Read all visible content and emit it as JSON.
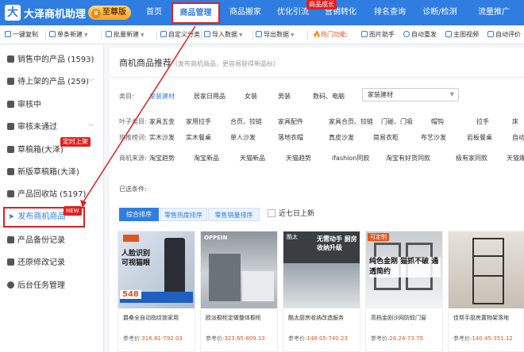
{
  "header": {
    "app_name": "大泽商机助理",
    "vip_label": "至尊版",
    "nav": [
      {
        "label": "首页"
      },
      {
        "label": "商品管理"
      },
      {
        "label": "商品搬家"
      },
      {
        "label": "优化引流"
      },
      {
        "label": "营销转化"
      },
      {
        "label": "排名查询"
      },
      {
        "label": "诊断/检测"
      },
      {
        "label": "流量推广"
      }
    ],
    "nav_badge": "商品成长"
  },
  "toolbar": {
    "items": [
      {
        "label": "一键复制",
        "icon": "copy-icon",
        "dropdown": false
      },
      {
        "label": "单条新建",
        "icon": "plus-circle-icon",
        "dropdown": true
      },
      {
        "label": "批量新建",
        "icon": "plus-circle-icon",
        "dropdown": true
      },
      {
        "label": "自定义分类",
        "icon": "folder-icon",
        "dropdown": false
      },
      {
        "label": "导入数据",
        "icon": "import-icon",
        "dropdown": true
      },
      {
        "label": "导出数据",
        "icon": "export-icon",
        "dropdown": true
      },
      {
        "label": "热门功能:",
        "icon": "fire-icon",
        "dropdown": false
      },
      {
        "label": "图片助手",
        "icon": "image-icon",
        "dropdown": false
      },
      {
        "label": "自动重发",
        "icon": "refresh-icon",
        "dropdown": false
      },
      {
        "label": "主图视频",
        "icon": "video-icon",
        "dropdown": false
      },
      {
        "label": "自动评价",
        "icon": "comment-icon",
        "dropdown": false
      }
    ]
  },
  "sidebar": {
    "items": [
      {
        "label": "销售中的产品 (1593)",
        "icon": "shop-icon",
        "chevron": true
      },
      {
        "label": "待上架的产品 (259)",
        "icon": "box-icon",
        "chevron": true
      },
      {
        "label": "审核中",
        "icon": "audit-icon",
        "chevron": false
      },
      {
        "label": "审核未通过",
        "icon": "audit-fail-icon",
        "chevron": true
      },
      {
        "label": "草稿箱(大泽)",
        "icon": "folder-icon",
        "chevron": false
      },
      {
        "label": "新版草稿箱(大泽)",
        "icon": "folder-icon",
        "chevron": false
      },
      {
        "label": "产品回收站 (5197)",
        "icon": "trash-icon",
        "chevron": false
      },
      {
        "label": "发布商机商品",
        "icon": "send-icon",
        "chevron": false
      },
      {
        "label": "产品备份记录",
        "icon": "backup-icon",
        "chevron": false
      },
      {
        "label": "还原修改记录",
        "icon": "restore-icon",
        "chevron": false
      },
      {
        "label": "后台任务管理",
        "icon": "task-icon",
        "chevron": false
      }
    ],
    "badge_scheduled": "定时上架",
    "badge_new": "NEW"
  },
  "main": {
    "title": "商机商品推荐",
    "subtitle": "（发布商机商品，更容易获得新品标）",
    "filters": [
      {
        "label": "类目:",
        "values": [
          "家装建材",
          "居家日用品",
          "女装",
          "男装",
          "数码、电脑"
        ],
        "selected": 0
      },
      {
        "label": "叶子类目:",
        "values": [
          "家具五金",
          "家用拉手",
          "合页、铰链",
          "家具配件",
          "家具合页、铰链",
          "门碰、门吸",
          "帽钩",
          "拉手",
          "床"
        ]
      },
      {
        "label": "热推榜词:",
        "values": [
          "实木沙发",
          "实木餐桌",
          "单人沙发",
          "落地衣帽",
          "真皮沙发",
          "简易衣柜",
          "布艺沙发",
          "岩板餐桌",
          "自动麻"
        ]
      },
      {
        "label": "商机来源:",
        "values": [
          "淘宝趋势",
          "淘宝新品",
          "天猫新品",
          "天猫趋势",
          "ifashion同款",
          "淘宝有好货同款",
          "极有家同款",
          "天猫爆品"
        ]
      }
    ],
    "category_select": "家装建材",
    "selected_conditions_label": "已选条件:",
    "sort_tabs": [
      {
        "label": "综合排序",
        "active": true
      },
      {
        "label": "零售热度排序",
        "active": false
      },
      {
        "label": "零售销量排序",
        "active": false
      }
    ],
    "recent_checkbox_label": "近七日上新",
    "products": [
      {
        "title": "爵桑全自动指纹锁家用",
        "price_label": "参考价:",
        "price": "316.81-792.03",
        "img_badge": "548",
        "img_text": "人脸识别 可视猫眼"
      },
      {
        "title": "欧派橱柜定做整体橱柜",
        "price_label": "参考价:",
        "price": "323.65-809.13",
        "img_badge": "",
        "img_text": "OPPEIN"
      },
      {
        "title": "酷太厨房收纳改造服务",
        "price_label": "参考价:",
        "price": "148.05-740.23",
        "img_badge": "",
        "img_text": "无需动手 厨房收纳升级"
      },
      {
        "title": "高档金刚沙网防蚊门窗",
        "price_label": "参考价:",
        "price": "26.24-73.75",
        "img_badge": "",
        "img_text": "纯色金刚 猫抓不破 通透简约"
      },
      {
        "title": "佳帮手厨房置物架落地",
        "price_label": "参考价:",
        "price": "140.45-351.12",
        "img_badge": "",
        "img_text": ""
      }
    ]
  },
  "colors": {
    "primary": "#2f7de1",
    "highlight": "#e02020",
    "price": "#e0561f"
  }
}
